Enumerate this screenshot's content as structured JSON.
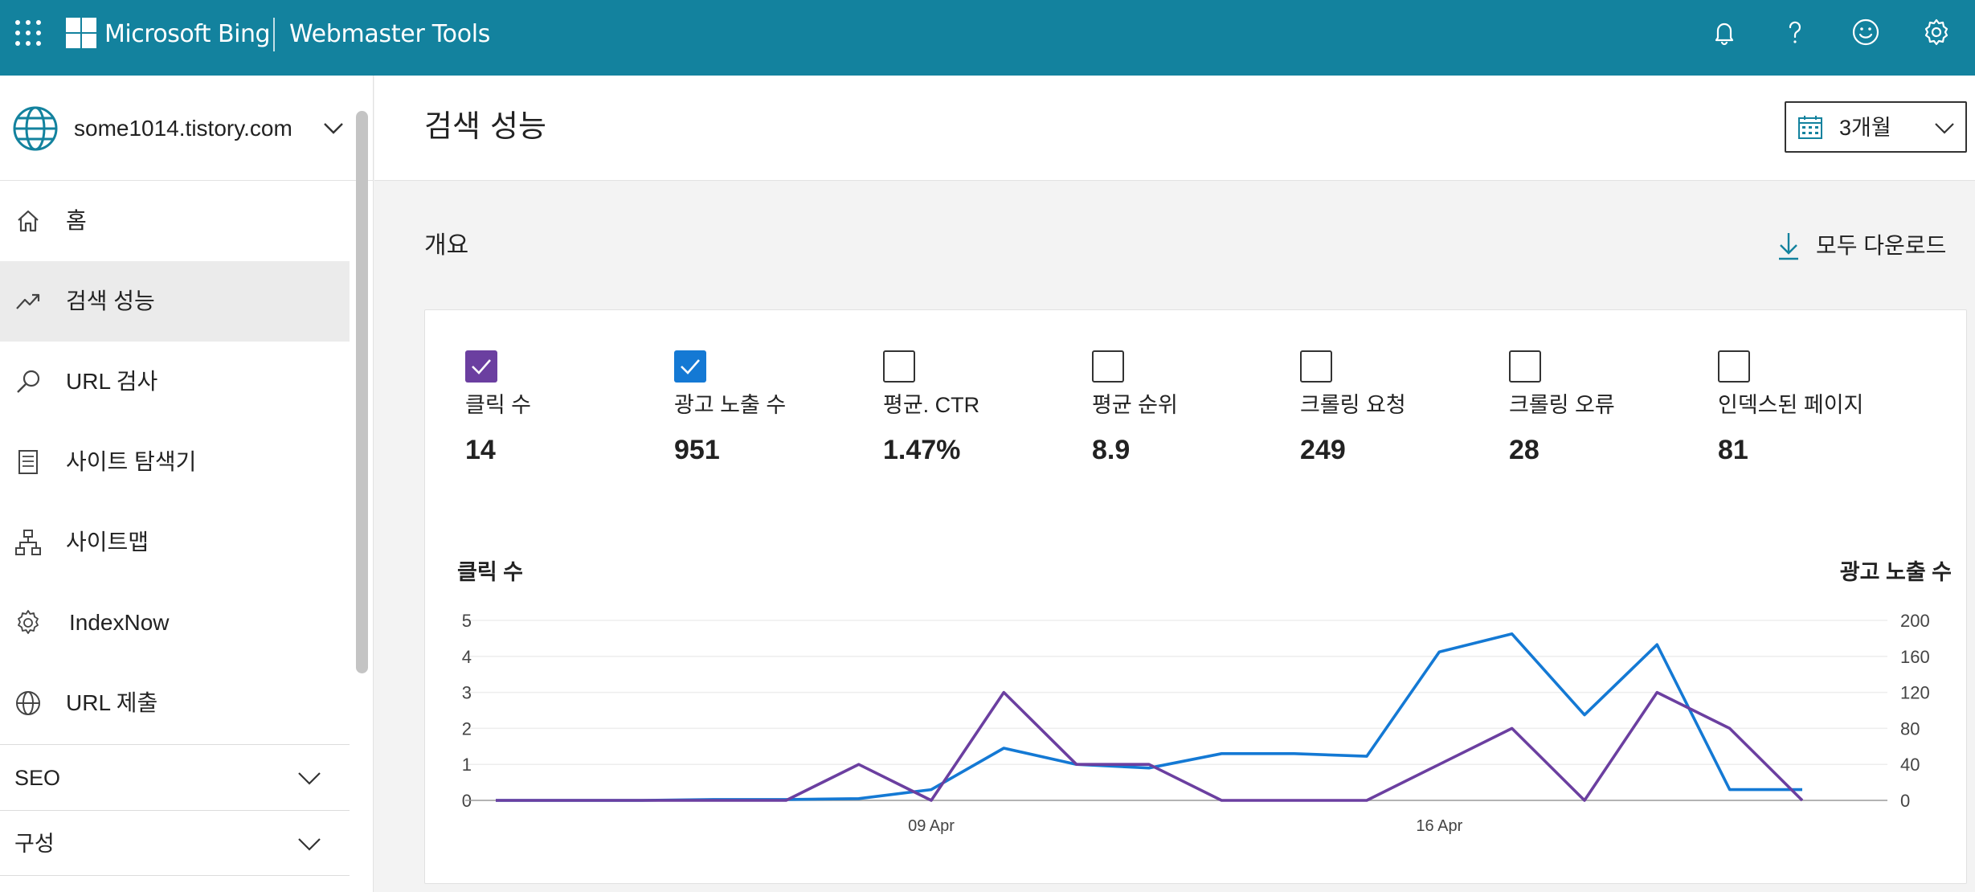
{
  "topbar": {
    "brand": "Microsoft Bing",
    "product": "Webmaster Tools",
    "icons": [
      "app-launcher-icon",
      "microsoft-logo-icon",
      "bell-icon",
      "help-icon",
      "feedback-smiley-icon",
      "gear-icon"
    ]
  },
  "sidebar": {
    "site": "some1014.tistory.com",
    "items": [
      {
        "label": "홈",
        "icon": "home-icon"
      },
      {
        "label": "검색 성능",
        "icon": "trend-icon",
        "active": true
      },
      {
        "label": "URL 검사",
        "icon": "search-icon"
      },
      {
        "label": "사이트 탐색기",
        "icon": "document-list-icon"
      },
      {
        "label": "사이트맵",
        "icon": "sitemap-icon"
      },
      {
        "label": "IndexNow",
        "icon": "indexnow-gear-icon"
      },
      {
        "label": "URL 제출",
        "icon": "globe-icon"
      }
    ],
    "sections": [
      {
        "label": "SEO"
      },
      {
        "label": "구성"
      }
    ]
  },
  "main": {
    "title": "검색 성능",
    "date_range": "3개월",
    "overview": "개요",
    "download_all": "모두 다운로드"
  },
  "metrics": [
    {
      "label": "클릭 수",
      "value": "14",
      "checked": true,
      "color": "#6b3fa0"
    },
    {
      "label": "광고 노출 수",
      "value": "951",
      "checked": true,
      "color": "#1479d4"
    },
    {
      "label": "평균. CTR",
      "value": "1.47%",
      "checked": false
    },
    {
      "label": "평균 순위",
      "value": "8.9",
      "checked": false
    },
    {
      "label": "크롤링 요청",
      "value": "249",
      "checked": false
    },
    {
      "label": "크롤링 오류",
      "value": "28",
      "checked": false
    },
    {
      "label": "인덱스된 페이지",
      "value": "81",
      "checked": false
    }
  ],
  "chart_data": {
    "type": "line",
    "ylabel": "클릭 수",
    "ylabel_right": "광고 노출 수",
    "ylim": [
      0,
      5
    ],
    "ylim_right": [
      0,
      200
    ],
    "yticks": [
      "0",
      "1",
      "2",
      "3",
      "4",
      "5"
    ],
    "yticks_right": [
      "0",
      "40",
      "80",
      "120",
      "160",
      "200"
    ],
    "x": [
      "03 Apr",
      "04 Apr",
      "05 Apr",
      "06 Apr",
      "07 Apr",
      "08 Apr",
      "09 Apr",
      "10 Apr",
      "11 Apr",
      "12 Apr",
      "13 Apr",
      "14 Apr",
      "15 Apr",
      "16 Apr",
      "17 Apr",
      "18 Apr",
      "19 Apr",
      "20 Apr",
      "21 Apr"
    ],
    "xtick_labels": [
      {
        "index": 6,
        "label": "09 Apr"
      },
      {
        "index": 13,
        "label": "16 Apr"
      }
    ],
    "grid": true,
    "series": [
      {
        "name": "클릭 수",
        "axis": "left",
        "color": "#6b3fa0",
        "values": [
          0,
          0,
          0,
          0,
          0,
          1,
          0,
          3,
          1,
          1,
          0,
          0,
          0,
          1,
          2,
          0,
          3,
          2,
          0
        ]
      },
      {
        "name": "광고 노출 수",
        "axis": "right",
        "color": "#1479d4",
        "values": [
          0,
          0,
          0,
          1,
          1,
          2,
          12,
          58,
          40,
          36,
          52,
          52,
          49,
          165,
          185,
          95,
          173,
          12,
          12
        ]
      }
    ]
  }
}
